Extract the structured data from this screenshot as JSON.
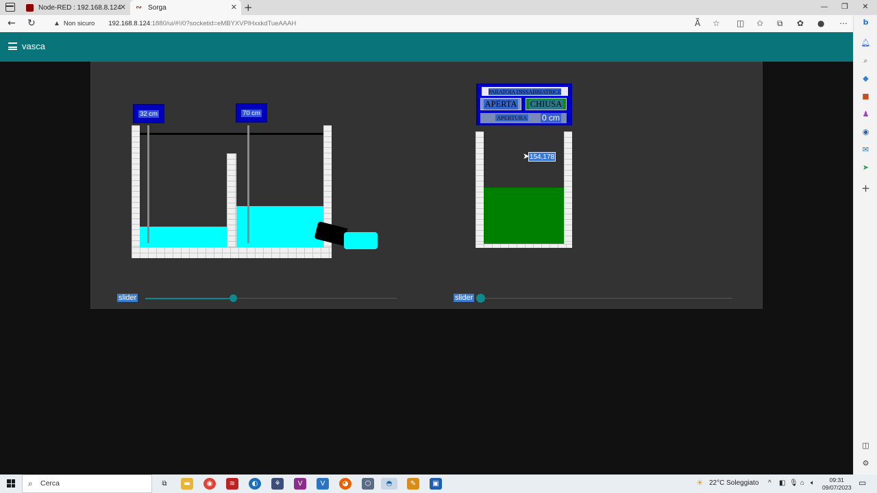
{
  "browser": {
    "tabs": [
      {
        "title": "Node-RED : 192.168.8.124"
      },
      {
        "title": "Sorga"
      }
    ],
    "security_label": "Non sicuro",
    "url_host": "192.168.8.124",
    "url_rest": ":1880/ui/#!/0?socketid=eMBYXVPlHxxkdTueAAAH"
  },
  "dashboard": {
    "title": "vasca"
  },
  "tank1": {
    "gauge_left": "32 cm",
    "gauge_right": "70 cm",
    "slider_label": "slider",
    "slider_value_fraction": 0.35
  },
  "tank2": {
    "panel_title": "PARATOIA DISSABBIATRICE",
    "open_label": "APERTA",
    "closed_label": "CHIUSA",
    "opening_label": "APERTURA",
    "opening_value": "0 cm",
    "readout": "154,178",
    "slider_label": "slider",
    "slider_value_fraction": 0.0
  },
  "taskbar": {
    "search_placeholder": "Cerca",
    "weather": "22°C  Soleggiato",
    "time": "09:31",
    "date": "09/07/2023"
  },
  "colors": {
    "header": "#097479",
    "water": "#00ffff",
    "tank2_fill": "#008000"
  }
}
